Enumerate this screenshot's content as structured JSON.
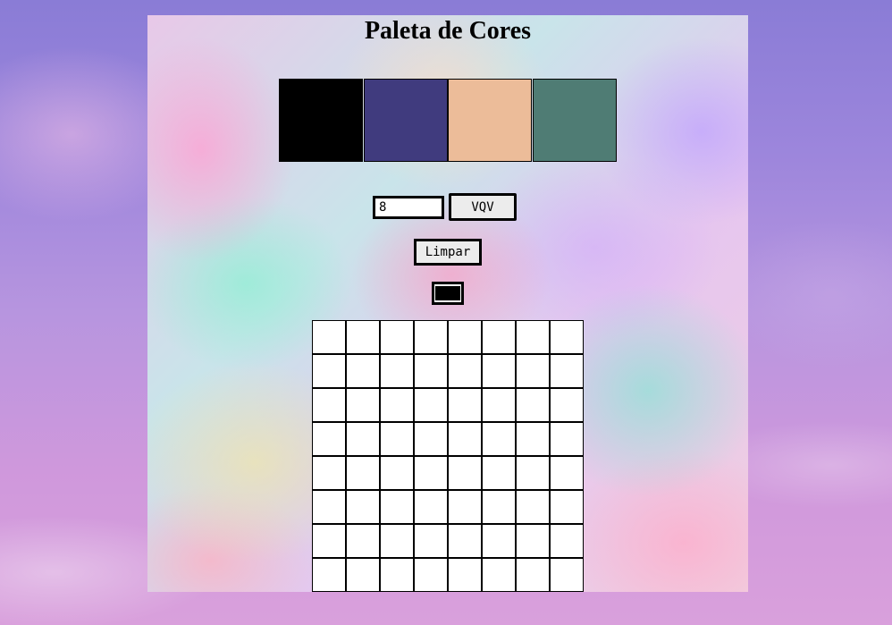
{
  "page": {
    "title": "Paleta de Cores"
  },
  "palette": {
    "colors": [
      "#000000",
      "#403b7e",
      "#ecbc99",
      "#4f7c74"
    ],
    "selected_index": 0
  },
  "controls": {
    "board_size_value": "8",
    "vqv_label": "VQV",
    "clear_label": "Limpar"
  },
  "board": {
    "rows": 8,
    "cols": 8,
    "pixel_color": "#ffffff"
  }
}
